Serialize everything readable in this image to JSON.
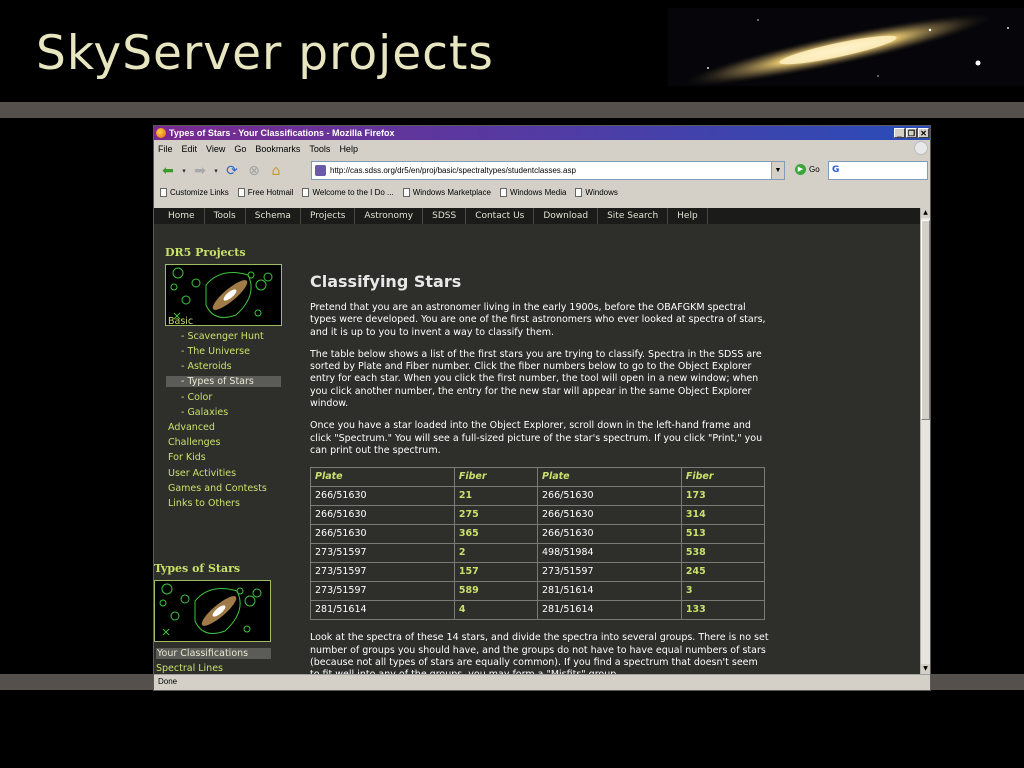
{
  "slide": {
    "title": "SkyServer projects"
  },
  "browser": {
    "window_title": "Types of Stars - Your Classifications - Mozilla Firefox",
    "menu": [
      "File",
      "Edit",
      "View",
      "Go",
      "Bookmarks",
      "Tools",
      "Help"
    ],
    "url": "http://cas.sdss.org/dr5/en/proj/basic/spectraltypes/studentclasses.asp",
    "go_label": "Go",
    "search_value": "G",
    "bookmarks": [
      "Customize Links",
      "Free Hotmail",
      "Welcome to the I Do ...",
      "Windows Marketplace",
      "Windows Media",
      "Windows"
    ],
    "status": "Done"
  },
  "site": {
    "nav": [
      "Home",
      "Tools",
      "Schema",
      "Projects",
      "Astronomy",
      "SDSS",
      "Contact Us",
      "Download",
      "Site Search",
      "Help"
    ],
    "sidebar": {
      "heading": "DR5 Projects",
      "basic": "Basic",
      "basic_items": [
        "- Scavenger Hunt",
        "- The Universe",
        "- Asteroids",
        "- Types of Stars",
        "- Color",
        "- Galaxies"
      ],
      "active_index": 3,
      "other_links": [
        "Advanced",
        "Challenges",
        "For Kids",
        "User Activities",
        "Games and Contests",
        "Links to Others"
      ],
      "section2_heading": "Types of Stars",
      "section2_links": [
        "Your Classifications",
        "Spectral Lines"
      ]
    },
    "main": {
      "title": "Classifying Stars",
      "p1": "Pretend that you are an astronomer living in the early 1900s, before the OBAFGKM spectral types were developed. You are one of the first astronomers who ever looked at spectra of stars, and it is up to you to invent a way to classify them.",
      "p2": "The table below shows a list of the first stars you are trying to classify. Spectra in the SDSS are sorted by Plate and Fiber number. Click the fiber numbers below to go to the Object Explorer entry for each star. When you click the first number, the tool will open in a new window; when you click another number, the entry for the new star will appear in the same Object Explorer window.",
      "p3": "Once you have a star loaded into the Object Explorer, scroll down in the left-hand frame and click \"Spectrum.\" You will see a full-sized picture of the star's spectrum. If you click \"Print,\" you can print out the spectrum.",
      "table_headers": [
        "Plate",
        "Fiber",
        "Plate",
        "Fiber"
      ],
      "table_rows": [
        [
          "266/51630",
          "21",
          "266/51630",
          "173"
        ],
        [
          "266/51630",
          "275",
          "266/51630",
          "314"
        ],
        [
          "266/51630",
          "365",
          "266/51630",
          "513"
        ],
        [
          "273/51597",
          "2",
          "498/51984",
          "538"
        ],
        [
          "273/51597",
          "157",
          "273/51597",
          "245"
        ],
        [
          "273/51597",
          "589",
          "281/51614",
          "3"
        ],
        [
          "281/51614",
          "4",
          "281/51614",
          "133"
        ]
      ],
      "p4": "Look at the spectra of these 14 stars, and divide the spectra into several groups. There is no set number of groups you should have, and the groups do not have to have equal numbers of stars (because not all types of stars are equally common). If you find a spectrum that doesn't seem to fit well into any of the groups, you may form a \"Misfits\" group."
    }
  },
  "colors": {
    "accent_green": "#c9e06a",
    "content_bg": "#2e2f2b",
    "slide_title": "#e8e6c0"
  }
}
